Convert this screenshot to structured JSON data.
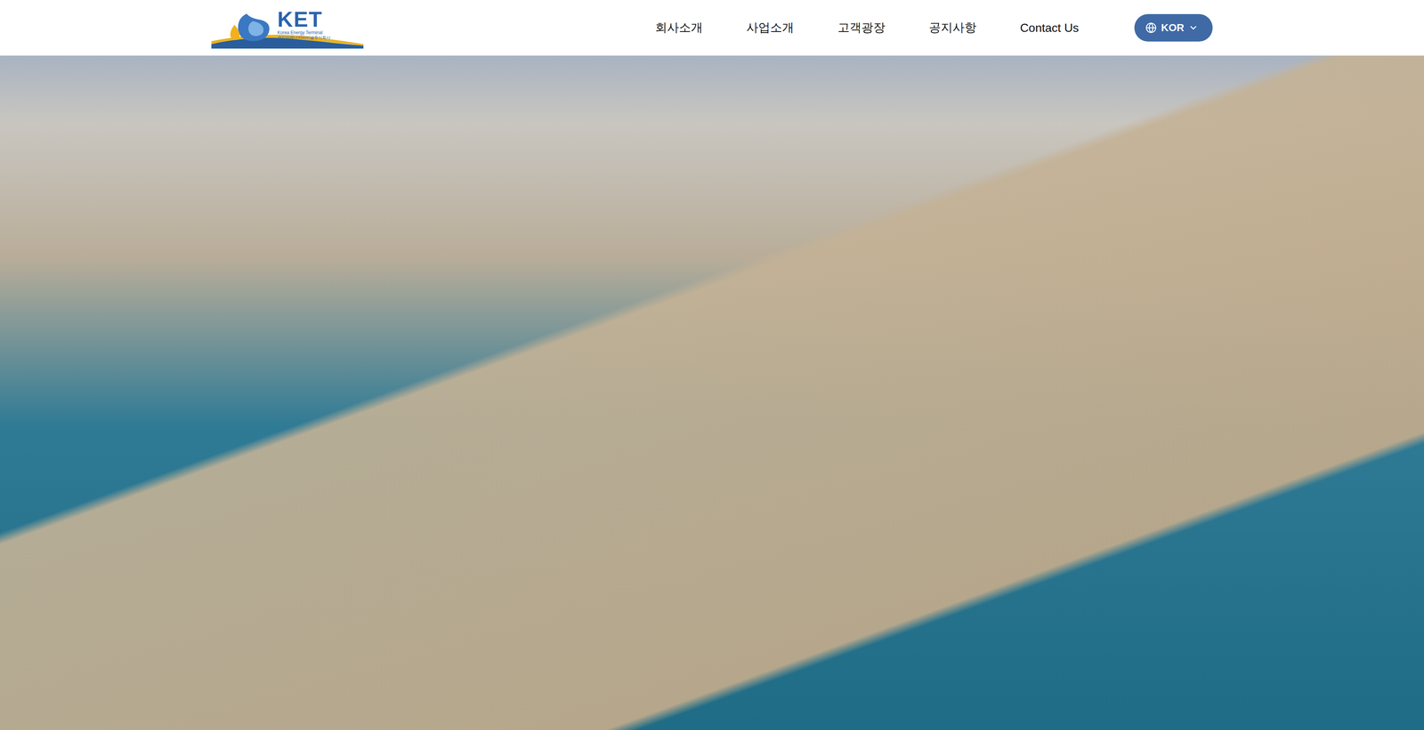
{
  "header": {
    "logo": {
      "name": "KET",
      "subtitle": "Korea Energy Terminal",
      "korean": "코리아에너지터미널주식회사"
    },
    "nav": [
      {
        "label": "회사소개"
      },
      {
        "label": "사업소개"
      },
      {
        "label": "고객광장"
      },
      {
        "label": "공지사항"
      },
      {
        "label": "Contact Us"
      }
    ],
    "language": {
      "label": "KOR"
    }
  },
  "hero": {
    "kind": "photo"
  }
}
